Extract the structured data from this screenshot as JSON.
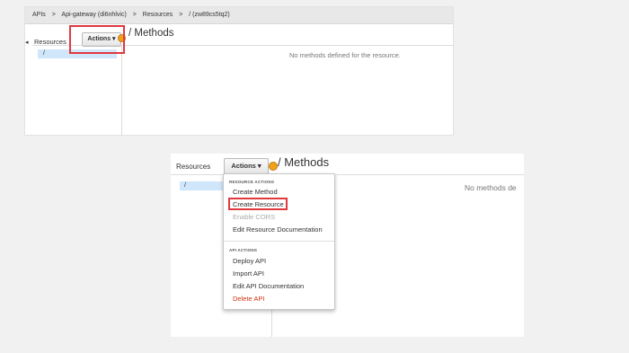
{
  "panel1": {
    "breadcrumb": [
      "APIs",
      ">",
      "Api-gateway (di6nhlvic)",
      ">",
      "Resources",
      ">",
      "/ (zw89cs5tq2)"
    ],
    "resources_label": "Resources",
    "actions_label": "Actions ▾",
    "methods_title": "/ Methods",
    "tree_item": "/",
    "empty_message": "No methods defined for the resource."
  },
  "panel2": {
    "resources_label": "Resources",
    "actions_label": "Actions ▾",
    "methods_title": "/ Methods",
    "tree_item": "/",
    "empty_message": "No methods de",
    "menu": {
      "resource_actions_title": "RESOURCE ACTIONS",
      "resource_actions": [
        "Create Method",
        "Create Resource",
        "Enable CORS",
        "Edit Resource Documentation"
      ],
      "api_actions_title": "API ACTIONS",
      "api_actions": [
        "Deploy API",
        "Import API",
        "Edit API Documentation",
        "Delete API"
      ]
    }
  },
  "colors": {
    "highlight_box": "#e0393e",
    "selected_tree_item": "#cfe6fb",
    "danger_text": "#d13212",
    "status_dot": "#f0a21b"
  }
}
